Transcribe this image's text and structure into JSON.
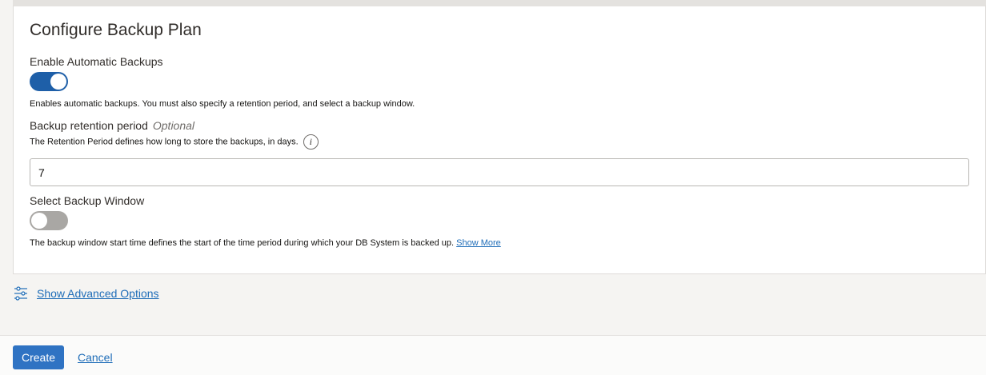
{
  "section": {
    "title": "Configure Backup Plan"
  },
  "automatic_backups": {
    "label": "Enable Automatic Backups",
    "enabled": true,
    "help": "Enables automatic backups. You must also specify a retention period, and select a backup window."
  },
  "retention": {
    "label": "Backup retention period",
    "optional": "Optional",
    "help": "The Retention Period defines how long to store the backups, in days.",
    "info_icon": "info-icon",
    "value": "7"
  },
  "backup_window": {
    "label": "Select Backup Window",
    "enabled": false,
    "help": "The backup window start time defines the start of the time period during which your DB System is backed up.",
    "show_more": "Show More"
  },
  "advanced": {
    "icon": "sliders-icon",
    "label": "Show Advanced Options"
  },
  "footer": {
    "create_label": "Create",
    "cancel_label": "Cancel"
  },
  "colors": {
    "primary": "#2f73c3",
    "toggle_on": "#1e5fa8",
    "toggle_off": "#a9a7a4",
    "link": "#1f6db8"
  }
}
